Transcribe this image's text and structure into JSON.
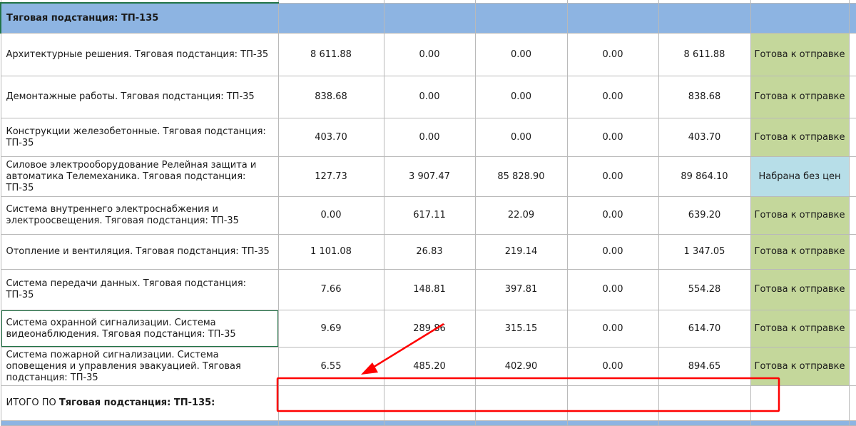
{
  "section": {
    "title": "Тяговая подстанция: ТП-135"
  },
  "rows": [
    {
      "name": "Архитектурные решения. Тяговая подстанция: ТП-35",
      "v1": "8 611.88",
      "v2": "0.00",
      "v3": "0.00",
      "v4": "0.00",
      "v5": "8 611.88",
      "status": "Готова к отправке",
      "status_type": "ready"
    },
    {
      "name": "Демонтажные работы. Тяговая подстанция: ТП-35",
      "v1": "838.68",
      "v2": "0.00",
      "v3": "0.00",
      "v4": "0.00",
      "v5": "838.68",
      "status": "Готова к отправке",
      "status_type": "ready"
    },
    {
      "name": "Конструкции железобетонные. Тяговая подстанция: ТП-35",
      "v1": "403.70",
      "v2": "0.00",
      "v3": "0.00",
      "v4": "0.00",
      "v5": "403.70",
      "status": "Готова к отправке",
      "status_type": "ready"
    },
    {
      "name": "Силовое электрооборудование Релейная защита и автоматика Телемеханика. Тяговая подстанция: ТП-35",
      "v1": "127.73",
      "v2": "3 907.47",
      "v3": "85 828.90",
      "v4": "0.00",
      "v5": "89 864.10",
      "status": "Набрана без цен",
      "status_type": "noprice"
    },
    {
      "name": "Система внутреннего электроснабжения и электроосвещения. Тяговая подстанция: ТП-35",
      "v1": "0.00",
      "v2": "617.11",
      "v3": "22.09",
      "v4": "0.00",
      "v5": "639.20",
      "status": "Готова к отправке",
      "status_type": "ready"
    },
    {
      "name": "Отопление и вентиляция. Тяговая подстанция: ТП-35",
      "v1": "1 101.08",
      "v2": "26.83",
      "v3": "219.14",
      "v4": "0.00",
      "v5": "1 347.05",
      "status": "Готова к отправке",
      "status_type": "ready"
    },
    {
      "name": "Система передачи данных. Тяговая подстанция: ТП-35",
      "v1": "7.66",
      "v2": "148.81",
      "v3": "397.81",
      "v4": "0.00",
      "v5": "554.28",
      "status": "Готова к отправке",
      "status_type": "ready"
    },
    {
      "name": "Система охранной сигнализации. Система видеонаблюдения. Тяговая подстанция: ТП-35",
      "v1": "9.69",
      "v2": "289.86",
      "v3": "315.15",
      "v4": "0.00",
      "v5": "614.70",
      "status": "Готова к отправке",
      "status_type": "ready"
    },
    {
      "name": "Система пожарной сигнализации. Система оповещения и управления эвакуацией. Тяговая подстанция: ТП-35",
      "v1": "6.55",
      "v2": "485.20",
      "v3": "402.90",
      "v4": "0.00",
      "v5": "894.65",
      "status": "Готова к отправке",
      "status_type": "ready"
    }
  ],
  "total": {
    "prefix": "ИТОГО ПО ",
    "bold_part": "Тяговая подстанция: ТП-135:"
  },
  "colors": {
    "header_bg": "#8db4e2",
    "ready_bg": "#c4d79b",
    "noprice_bg": "#b7dee8",
    "highlight": "#ff0000",
    "selection": "#217346"
  }
}
